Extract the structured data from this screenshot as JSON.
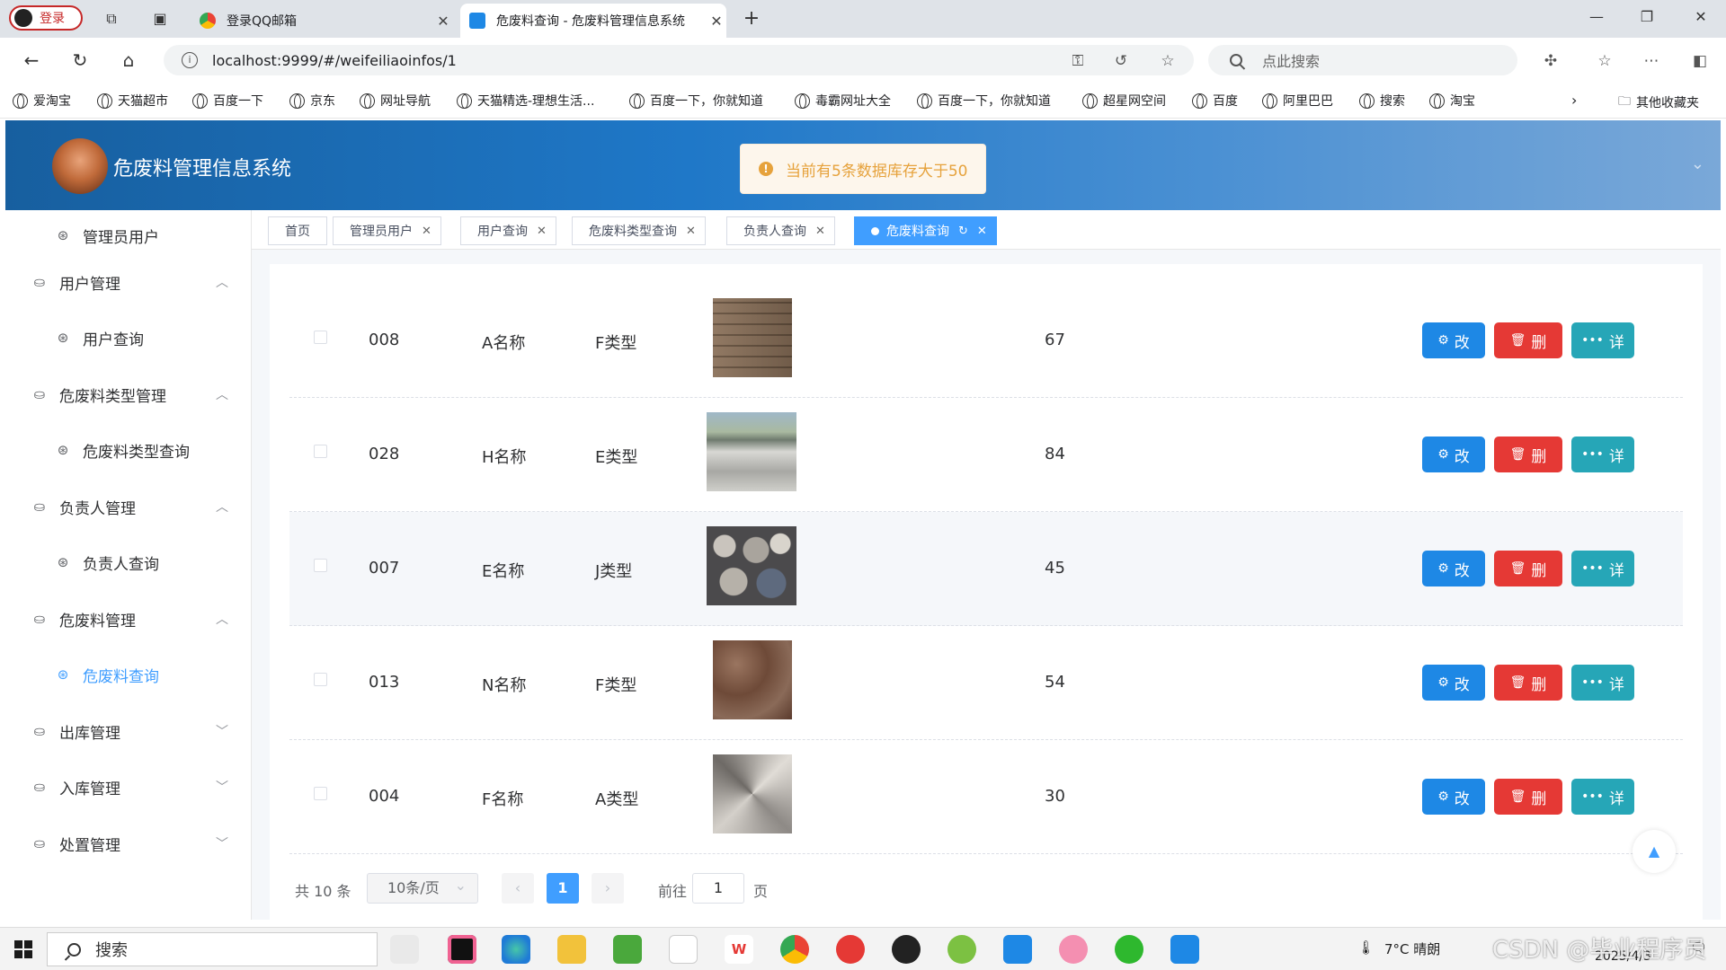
{
  "browser": {
    "login_label": "登录",
    "tabs": [
      {
        "title": "登录QQ邮箱",
        "fav_color": "#34a853"
      },
      {
        "title": "危废料查询 - 危废料管理信息系统",
        "fav_color": "#1e88e5"
      }
    ],
    "new_tab": "+",
    "url": "localhost:9999/#/weifeiliaoinfos/1",
    "search_placeholder": "点此搜索",
    "bookmarks": [
      "爱淘宝",
      "天猫超市",
      "百度一下",
      "京东",
      "网址导航",
      "天猫精选-理想生活...",
      "百度一下，你就知道",
      "毒霸网址大全",
      "百度一下，你就知道",
      "超星网空间",
      "百度",
      "阿里巴巴",
      "搜索",
      "淘宝"
    ],
    "bookmarks_more": "其他收藏夹"
  },
  "app": {
    "title": "危废料管理信息系统",
    "toast": "当前有5条数据库存大于50"
  },
  "sidebar": {
    "items": [
      {
        "label": "管理员用户",
        "level": 2,
        "active": false
      },
      {
        "label": "用户管理",
        "level": 1,
        "arrow": "^"
      },
      {
        "label": "用户查询",
        "level": 2,
        "active": false
      },
      {
        "label": "危废料类型管理",
        "level": 1,
        "arrow": "^"
      },
      {
        "label": "危废料类型查询",
        "level": 2,
        "active": false
      },
      {
        "label": "负责人管理",
        "level": 1,
        "arrow": "^"
      },
      {
        "label": "负责人查询",
        "level": 2,
        "active": false
      },
      {
        "label": "危废料管理",
        "level": 1,
        "arrow": "^"
      },
      {
        "label": "危废料查询",
        "level": 2,
        "active": true
      },
      {
        "label": "出库管理",
        "level": 1,
        "arrow": "v"
      },
      {
        "label": "入库管理",
        "level": 1,
        "arrow": "v"
      },
      {
        "label": "处置管理",
        "level": 1,
        "arrow": "v"
      }
    ]
  },
  "tags": [
    {
      "label": "首页",
      "closable": false,
      "active": false
    },
    {
      "label": "管理员用户",
      "closable": true,
      "active": false
    },
    {
      "label": "用户查询",
      "closable": true,
      "active": false
    },
    {
      "label": "危废料类型查询",
      "closable": true,
      "active": false
    },
    {
      "label": "负责人查询",
      "closable": true,
      "active": false
    },
    {
      "label": "危废料查询",
      "closable": true,
      "active": true
    }
  ],
  "table": {
    "rows": [
      {
        "code": "008",
        "name": "A名称",
        "type": "F类型",
        "qty": "67",
        "img": "stone-wall"
      },
      {
        "code": "028",
        "name": "H名称",
        "type": "E类型",
        "qty": "84",
        "img": "concrete-slabs"
      },
      {
        "code": "007",
        "name": "E名称",
        "type": "J类型",
        "qty": "45",
        "img": "round-stones"
      },
      {
        "code": "013",
        "name": "N名称",
        "type": "F类型",
        "qty": "54",
        "img": "brown-marble"
      },
      {
        "code": "004",
        "name": "F名称",
        "type": "A类型",
        "qty": "30",
        "img": "grey-tile"
      }
    ],
    "actions": {
      "edit": "改",
      "delete": "删",
      "detail": "详"
    }
  },
  "pagination": {
    "total": "共 10 条",
    "page_size": "10条/页",
    "current": "1",
    "goto_label": "前往",
    "goto_value": "1",
    "page_suffix": "页",
    "prev": "‹",
    "next": "›"
  },
  "taskbar": {
    "search": "搜索",
    "weather": "7°C 晴朗",
    "date": "2025/4/3",
    "watermark": "CSDN @毕业程序员"
  },
  "colors": {
    "primary": "#409eff",
    "edit": "#1e88e5",
    "delete": "#e53935",
    "detail": "#26a6b7",
    "toast": "#e6a23c"
  }
}
